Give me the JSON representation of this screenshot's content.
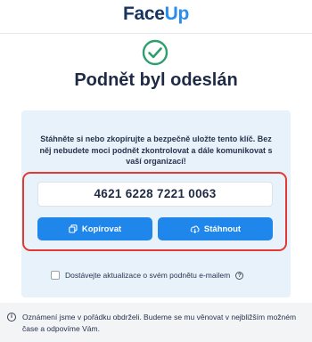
{
  "header": {
    "logo_prefix": "Face",
    "logo_suffix": "Up"
  },
  "confirmation": {
    "title": "Podnět byl odeslán",
    "instructions": "Stáhněte si nebo zkopírujte a bezpečně uložte tento klíč. Bez něj nebudete moci podnět zkontrolovat a dále komunikovat s vaší organizací!",
    "key": "4621 6228 7221 0063",
    "copy_label": "Kopírovat",
    "download_label": "Stáhnout",
    "updates_label": "Dostávejte aktualizace o svém podnětu e-mailem"
  },
  "footer": {
    "info_text": "Oznámení jsme v pořádku obdrželi. Budeme se mu věnovat v nejbližším možném čase a odpovíme Vám."
  },
  "colors": {
    "accent": "#1f86ec",
    "success": "#2f9e6e",
    "highlight": "#e23a32",
    "brand": "#17345f"
  },
  "icons": [
    "check-circle-icon",
    "copy-icon",
    "cloud-download-icon",
    "help-icon",
    "info-icon"
  ]
}
